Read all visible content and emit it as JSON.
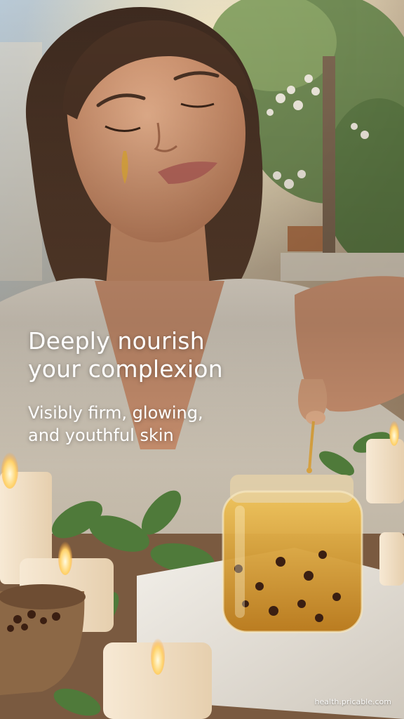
{
  "overlay": {
    "headline_line1": "Deeply nourish",
    "headline_line2": "your complexion",
    "subhead_line1": "Visibly firm, glowing,",
    "subhead_line2": "and youthful skin"
  },
  "watermark": "health.pricable.com",
  "colors": {
    "text": "#ffffff",
    "oil": "#d9a23a",
    "skin": "#d9a07f",
    "foliage": "#4f7a3a"
  }
}
